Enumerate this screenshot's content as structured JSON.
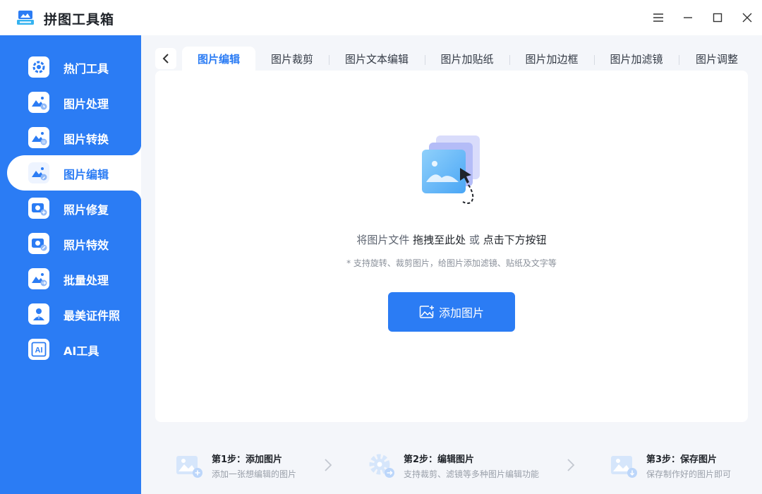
{
  "app": {
    "title": "拼图工具箱"
  },
  "sidebar": {
    "items": [
      {
        "label": "热门工具",
        "icon": "gear-icon"
      },
      {
        "label": "图片处理",
        "icon": "image-clock-icon"
      },
      {
        "label": "图片转换",
        "icon": "image-convert-icon"
      },
      {
        "label": "图片编辑",
        "icon": "image-edit-icon",
        "active": true
      },
      {
        "label": "照片修复",
        "icon": "camera-plus-icon"
      },
      {
        "label": "照片特效",
        "icon": "camera-wand-icon"
      },
      {
        "label": "批量处理",
        "icon": "image-batch-icon"
      },
      {
        "label": "最美证件照",
        "icon": "id-photo-icon"
      },
      {
        "label": "AI工具",
        "icon": "ai-icon"
      }
    ]
  },
  "tabs": [
    {
      "label": "图片编辑",
      "active": true
    },
    {
      "label": "图片裁剪"
    },
    {
      "label": "图片文本编辑"
    },
    {
      "label": "图片加贴纸"
    },
    {
      "label": "图片加边框"
    },
    {
      "label": "图片加滤镜"
    },
    {
      "label": "图片调整"
    }
  ],
  "drop": {
    "text_prefix": "将图片文件 ",
    "text_drag": "拖拽至此处",
    "text_or": " 或 ",
    "text_click": "点击下方按钮",
    "hint": "* 支持旋转、裁剪图片，给图片添加滤镜、贴纸及文字等",
    "button_label": "添加图片"
  },
  "steps": [
    {
      "title": "第1步：添加图片",
      "desc": "添加一张想编辑的图片"
    },
    {
      "title": "第2步：编辑图片",
      "desc": "支持裁剪、滤镜等多种图片编辑功能"
    },
    {
      "title": "第3步：保存图片",
      "desc": "保存制作好的图片即可"
    }
  ],
  "colors": {
    "brand": "#2b7cf4",
    "background": "#f4f6fa"
  }
}
